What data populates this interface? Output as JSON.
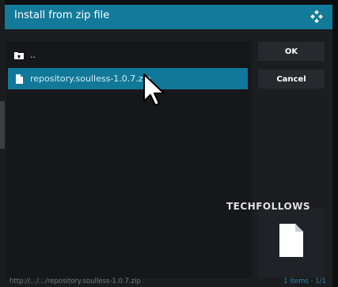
{
  "dialog": {
    "title": "Install from zip file",
    "title_icon": "kodi-logo-icon"
  },
  "list": {
    "items": [
      {
        "label": "..",
        "icon": "folder-up-icon",
        "selected": false
      },
      {
        "label": "repository.soulless-1.0.7.zip",
        "icon": "file-icon",
        "selected": true
      }
    ]
  },
  "buttons": {
    "ok": "OK",
    "cancel": "Cancel"
  },
  "watermark": "TECHFOLLOWS",
  "preview": {
    "icon": "file-icon"
  },
  "footer": {
    "path": "http://.../.../repository.soulless-1.0.7.zip",
    "count": "1 items - 1/1"
  },
  "colors": {
    "accent": "#137a9a",
    "dialog_bg": "#1b1d20",
    "list_bg": "#15171a",
    "button_bg": "#26292d"
  }
}
